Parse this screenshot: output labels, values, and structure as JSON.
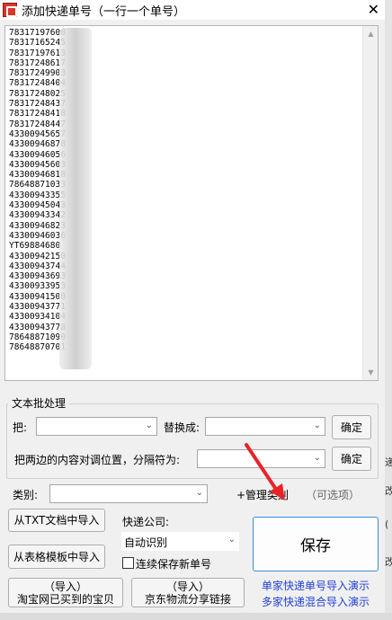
{
  "window": {
    "title": "添加快递单号（一行一个单号）",
    "close_glyph": "✕"
  },
  "list": {
    "lines": [
      "78317197608",
      "78317165245",
      "78317197613",
      "78317248617",
      "78317249903",
      "78317248404",
      "78317248025",
      "78317248437",
      "78317248418",
      "78317248447",
      "43300945657",
      "43300946878",
      "43300946056",
      "43300945603",
      "43300946818",
      "78648871033",
      "43300943355",
      "43300945043",
      "43300943342",
      "43300946823",
      "43300946036",
      "YT69884680",
      "43300942150",
      "43300943744",
      "43300943693",
      "43300933953",
      "43300941508",
      "43300943771",
      "43300934104",
      "43300943778",
      "78648871090",
      "78648870701"
    ]
  },
  "batch": {
    "group_title": "文本批处理",
    "replace_label": "把:",
    "replace_with_label": "替换成:",
    "confirm1": "确定",
    "swap_label": "把两边的内容对调位置，分隔符为:",
    "confirm2": "确定"
  },
  "category": {
    "label": "类别:",
    "manage": "+管理类别",
    "optional": "（可选项）"
  },
  "courier": {
    "label": "快递公司:",
    "value": "自动识别",
    "save_new_label": "连续保存新单号"
  },
  "buttons": {
    "import_txt": "从TXT文档中导入",
    "import_excel": "从表格模板中导入",
    "import_taobao_line1": "（导入）",
    "import_taobao_line2": "淘宝网已买到的宝贝",
    "import_jd_line1": "（导入）",
    "import_jd_line2": "京东物流分享链接",
    "save": "保存"
  },
  "links": {
    "single_demo": "单家快递单号导入演示",
    "multi_demo": "多家快递混合导入演示"
  },
  "edge_fragments": {
    "a": "递",
    "b": "改",
    "c": "(",
    "d": "改"
  },
  "colors": {
    "link": "#1f3fd8",
    "save_border": "#3b8fd6",
    "annotation_arrow": "#e8232a"
  }
}
